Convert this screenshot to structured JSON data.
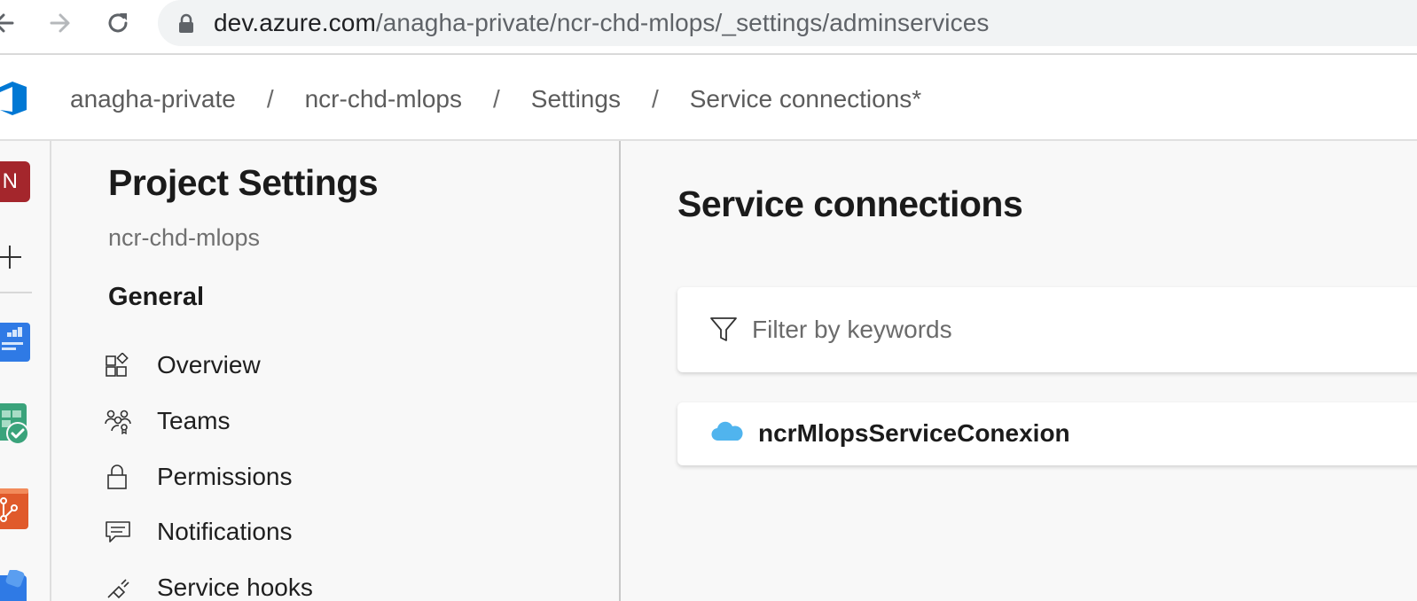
{
  "browser": {
    "url_host": "dev.azure.com",
    "url_path": "/anagha-private/ncr-chd-mlops/_settings/adminservices"
  },
  "breadcrumb": [
    {
      "label": "anagha-private"
    },
    {
      "label": "ncr-chd-mlops"
    },
    {
      "label": "Settings"
    },
    {
      "label": "Service connections*"
    }
  ],
  "breadcrumb_separator": "/",
  "rail": {
    "org_initial": "N"
  },
  "settings_nav": {
    "title": "Project Settings",
    "project_name": "ncr-chd-mlops",
    "section_general": "General",
    "items": [
      {
        "label": "Overview",
        "icon": "overview-icon"
      },
      {
        "label": "Teams",
        "icon": "teams-icon"
      },
      {
        "label": "Permissions",
        "icon": "lock-icon"
      },
      {
        "label": "Notifications",
        "icon": "chat-icon"
      },
      {
        "label": "Service hooks",
        "icon": "plug-icon"
      }
    ]
  },
  "main": {
    "title": "Service connections",
    "filter_placeholder": "Filter by keywords",
    "connections": [
      {
        "name": "ncrMlopsServiceConexion",
        "icon": "cloud-icon"
      }
    ]
  },
  "colors": {
    "org_avatar": "#a4262c",
    "azure_blue": "#0078d4",
    "cloud": "#50b4ee"
  }
}
